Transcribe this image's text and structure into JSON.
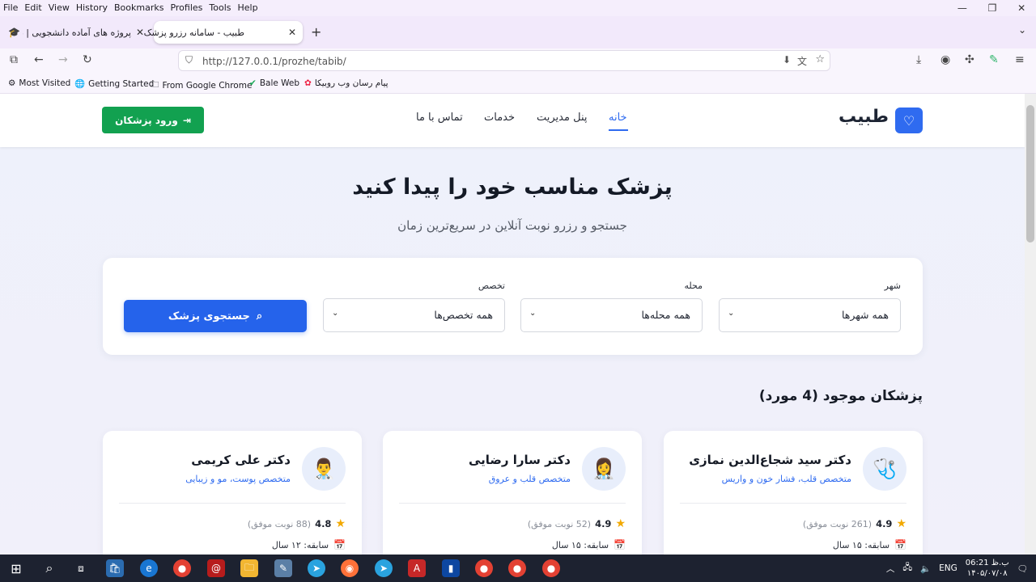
{
  "browser": {
    "menu": [
      "File",
      "Edit",
      "View",
      "History",
      "Bookmarks",
      "Profiles",
      "Tools",
      "Help"
    ],
    "tabs": [
      {
        "title": "پروژه های آماده دانشجویی | دانلود"
      },
      {
        "title": "طبیب - سامانه رزرو پزشک"
      }
    ],
    "url": "http://127.0.0.1/prozhe/tabib/",
    "bookmarks": [
      "Most Visited",
      "Getting Started",
      "From Google Chrome",
      "Bale Web",
      "پیام رسان وب روبیکا"
    ]
  },
  "site": {
    "logo": "طبیب",
    "nav": [
      "خانه",
      "پنل مدیریت",
      "خدمات",
      "تماس با ما"
    ],
    "login_button": "ورود پزشکان"
  },
  "hero": {
    "title": "پزشک مناسب خود را پیدا کنید",
    "subtitle": "جستجو و رزرو نوبت آنلاین در سریع‌ترین زمان"
  },
  "search": {
    "city_label": "شهر",
    "city_value": "همه شهرها",
    "area_label": "محله",
    "area_value": "همه محله‌ها",
    "specialty_label": "تخصص",
    "specialty_value": "همه تخصص‌ها",
    "button": "جستجوی پزشک"
  },
  "list": {
    "title": "پزشکان موجود (4 مورد)",
    "doctors": [
      {
        "name": "دکتر سید شجاع‌الدین نمازی",
        "specialty": "متخصص قلب، فشار خون و واریس",
        "score": "4.9",
        "reviews": "(261 نوبت موفق)",
        "experience": "سابقه: ۱۵ سال",
        "avatar_icon": "stethoscope-icon"
      },
      {
        "name": "دکتر سارا رضایی",
        "specialty": "متخصص قلب و عروق",
        "score": "4.9",
        "reviews": "(52 نوبت موفق)",
        "experience": "سابقه: ۱۵ سال",
        "avatar_icon": "woman-doctor-icon"
      },
      {
        "name": "دکتر علی کریمی",
        "specialty": "متخصص پوست، مو و زیبایی",
        "score": "4.8",
        "reviews": "(88 نوبت موفق)",
        "experience": "سابقه: ۱۲ سال",
        "avatar_icon": "man-doctor-icon"
      }
    ]
  },
  "taskbar": {
    "lang": "ENG",
    "time": "ب.ظ 06:21",
    "date": "۱۴۰۵/۰۷/۰۸"
  },
  "colors": {
    "primary": "#2563eb",
    "success": "#12a150",
    "accent_text": "#2f6bf0"
  }
}
